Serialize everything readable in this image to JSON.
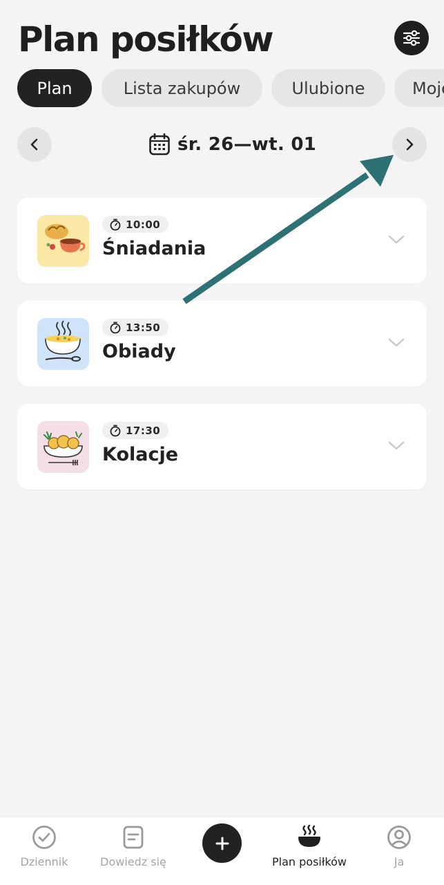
{
  "header": {
    "title": "Plan posiłków",
    "filter_icon": "sliders-icon"
  },
  "tabs": [
    {
      "label": "Plan",
      "active": true
    },
    {
      "label": "Lista zakupów",
      "active": false
    },
    {
      "label": "Ulubione",
      "active": false
    },
    {
      "label": "Moje",
      "active": false
    }
  ],
  "date_nav": {
    "range": "śr. 26—wt. 01",
    "prev_icon": "chevron-left-icon",
    "next_icon": "chevron-right-icon",
    "calendar_icon": "calendar-icon"
  },
  "meals": [
    {
      "time": "10:00",
      "name": "Śniadania",
      "thumb_color": "#fbe7a6"
    },
    {
      "time": "13:50",
      "name": "Obiady",
      "thumb_color": "#cfe3fb"
    },
    {
      "time": "17:30",
      "name": "Kolacje",
      "thumb_color": "#f4dfe6"
    }
  ],
  "annotation": {
    "color": "#2e7175",
    "points_to": "next-date-button"
  },
  "bottom_nav": [
    {
      "label": "Dziennik",
      "icon": "check-circle-icon",
      "active": false
    },
    {
      "label": "Dowiedz się",
      "icon": "article-icon",
      "active": false
    },
    {
      "label": "",
      "icon": "plus-icon",
      "active": false
    },
    {
      "label": "Plan posiłków",
      "icon": "food-bowl-icon",
      "active": true
    },
    {
      "label": "Ja",
      "icon": "profile-icon",
      "active": false
    }
  ]
}
